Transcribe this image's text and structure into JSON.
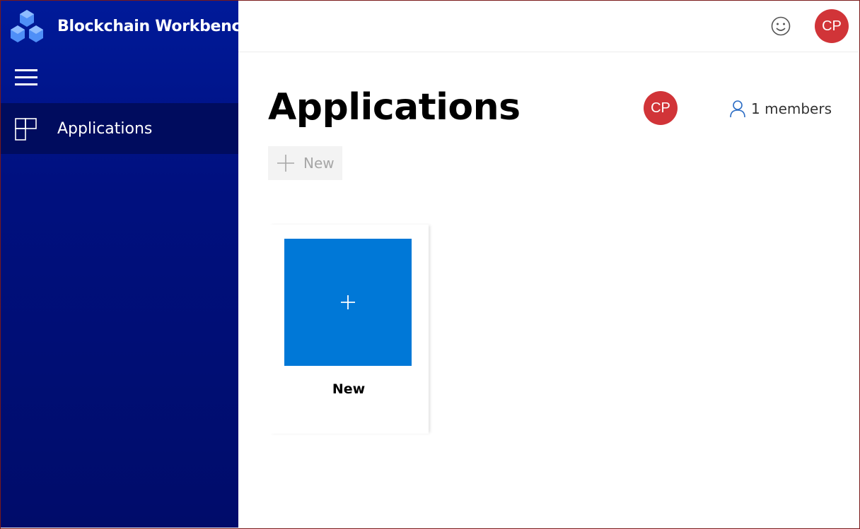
{
  "app": {
    "title": "Blockchain Workbench"
  },
  "colors": {
    "sidebar_top": "#001a99",
    "sidebar_bottom": "#000c6a",
    "nav_active": "#000c5e",
    "accent_tile": "#0078d7",
    "avatar": "#d13438"
  },
  "sidebar": {
    "items": [
      {
        "label": "Applications",
        "icon": "tiles-icon",
        "active": true
      }
    ]
  },
  "topbar": {
    "feedback_icon": "smiley-icon",
    "user_initials": "CP"
  },
  "main": {
    "title": "Applications",
    "owner_initials": "CP",
    "members_label": "1 members",
    "new_button_label": "New",
    "cards": [
      {
        "label": "New",
        "icon": "plus-icon"
      }
    ]
  }
}
